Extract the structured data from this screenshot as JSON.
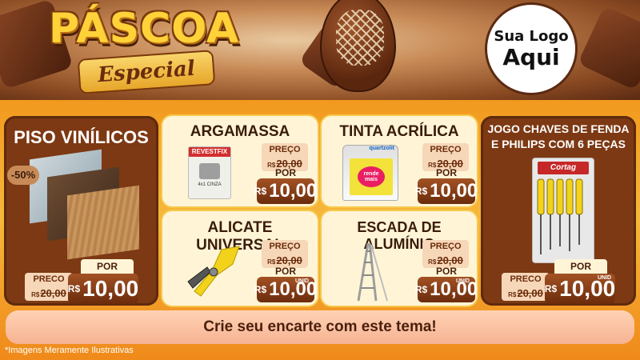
{
  "header": {
    "title": "PÁSCOA",
    "subtitle": "Especial",
    "logo_line1": "Sua Logo",
    "logo_line2": "Aqui"
  },
  "products": {
    "piso": {
      "name": "PISO VINÍLICOS",
      "discount": "-50%",
      "preco_label": "PRECO",
      "old_currency": "R$",
      "old_price": "20,00",
      "por_label": "POR",
      "currency": "R$",
      "price": "10,00"
    },
    "argamassa": {
      "name": "ARGAMASSA",
      "brand": "REVESTFIX",
      "package_text": "4x1 CINZA",
      "preco_label": "PREÇO",
      "old_currency": "R$",
      "old_price": "20,00",
      "por_label": "POR",
      "currency": "R$",
      "price": "10,00"
    },
    "tinta": {
      "name": "TINTA ACRÍLICA",
      "brand": "quartzolit",
      "can_text": "rende mais",
      "preco_label": "PREÇO",
      "old_currency": "R$",
      "old_price": "20,00",
      "por_label": "POR",
      "currency": "R$",
      "price": "10,00"
    },
    "alicate": {
      "name": "ALICATE UNIVERSAL",
      "preco_label": "PREÇO",
      "old_currency": "R$",
      "old_price": "20,00",
      "por_label": "POR",
      "currency": "R$",
      "price": "10,00",
      "unit": "UNID"
    },
    "escada": {
      "name": "ESCADA DE ALUMÍNIO",
      "preco_label": "PREÇO",
      "old_currency": "R$",
      "old_price": "20,00",
      "por_label": "POR",
      "currency": "R$",
      "price": "10,00",
      "unit": "UNID"
    },
    "chaves": {
      "name_line1": "JOGO CHAVES DE FENDA",
      "name_line2": "E PHILIPS COM 6 PEÇAS",
      "brand": "Cortag",
      "preco_label": "PRECO",
      "old_currency": "R$",
      "old_price": "20,00",
      "por_label": "POR",
      "currency": "R$",
      "price": "10,00",
      "unit": "UNID"
    }
  },
  "cta": "Crie seu encarte com este tema!",
  "footnote": "*Imagens Meramente Ilustrativas",
  "colors": {
    "chocolate": "#7d3913",
    "orange": "#f29a1f",
    "cream": "#fff5d6",
    "gold": "#ffd23a",
    "yellow_tool": "#f2d21a"
  }
}
